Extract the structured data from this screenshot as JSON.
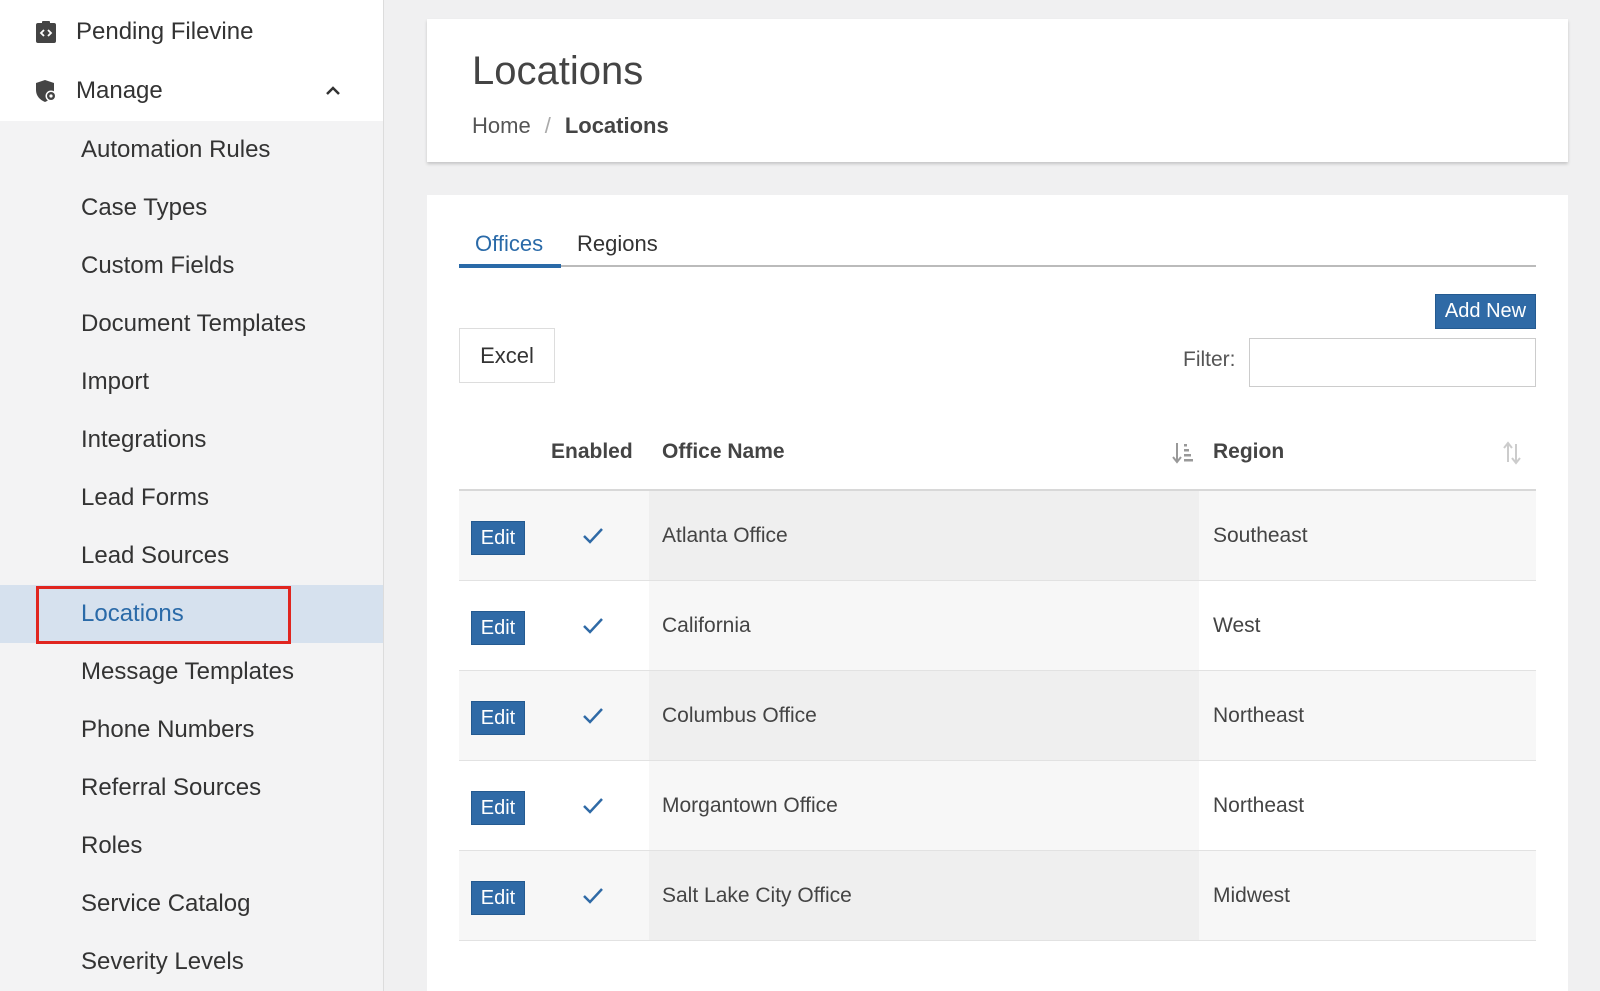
{
  "sidebar": {
    "pending": {
      "label": "Pending Filevine",
      "icon": "code-clipboard-icon"
    },
    "manage": {
      "label": "Manage",
      "icon": "shield-gear-icon",
      "expanded": true
    },
    "items": [
      {
        "label": "Automation Rules",
        "active": false
      },
      {
        "label": "Case Types",
        "active": false
      },
      {
        "label": "Custom Fields",
        "active": false
      },
      {
        "label": "Document Templates",
        "active": false
      },
      {
        "label": "Import",
        "active": false
      },
      {
        "label": "Integrations",
        "active": false
      },
      {
        "label": "Lead Forms",
        "active": false
      },
      {
        "label": "Lead Sources",
        "active": false
      },
      {
        "label": "Locations",
        "active": true
      },
      {
        "label": "Message Templates",
        "active": false
      },
      {
        "label": "Phone Numbers",
        "active": false
      },
      {
        "label": "Referral Sources",
        "active": false
      },
      {
        "label": "Roles",
        "active": false
      },
      {
        "label": "Service Catalog",
        "active": false
      },
      {
        "label": "Severity Levels",
        "active": false
      }
    ]
  },
  "header": {
    "title": "Locations",
    "breadcrumb": {
      "home": "Home",
      "separator": "/",
      "current": "Locations"
    }
  },
  "tabs": [
    {
      "label": "Offices",
      "active": true
    },
    {
      "label": "Regions",
      "active": false
    }
  ],
  "toolbar": {
    "add_new_label": "Add New",
    "excel_label": "Excel",
    "filter_label": "Filter:",
    "filter_value": ""
  },
  "table": {
    "columns": {
      "enabled": "Enabled",
      "office_name": "Office Name",
      "region": "Region"
    },
    "edit_label": "Edit",
    "rows": [
      {
        "enabled": true,
        "office_name": "Atlanta Office",
        "region": "Southeast"
      },
      {
        "enabled": true,
        "office_name": "California",
        "region": "West"
      },
      {
        "enabled": true,
        "office_name": "Columbus Office",
        "region": "Northeast"
      },
      {
        "enabled": true,
        "office_name": "Morgantown Office",
        "region": "Northeast"
      },
      {
        "enabled": true,
        "office_name": "Salt Lake City Office",
        "region": "Midwest"
      }
    ]
  },
  "colors": {
    "accent": "#2f6aa6",
    "active_bg": "#d6e1ee",
    "highlight": "#e0251f"
  }
}
